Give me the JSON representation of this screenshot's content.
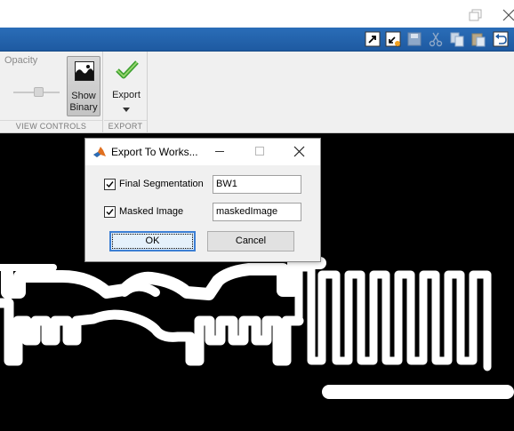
{
  "window": {
    "restore_icon": "restore-icon",
    "close_icon": "close-icon"
  },
  "quick_access": {
    "icons": [
      "undock-icon",
      "dock-icon",
      "save-icon",
      "cut-icon",
      "copy-icon",
      "paste-icon",
      "undo-icon"
    ]
  },
  "toolstrip": {
    "view_controls": {
      "opacity_label": "Opacity",
      "opacity_value": 0.55,
      "show_binary_line1": "Show",
      "show_binary_line2": "Binary",
      "section_label": "VIEW CONTROLS"
    },
    "export": {
      "export_label": "Export",
      "section_label": "EXPORT"
    }
  },
  "dialog": {
    "title": "Export To Works...",
    "rows": [
      {
        "checked": true,
        "label": "Final Segmentation",
        "value": "BW1"
      },
      {
        "checked": true,
        "label": "Masked Image",
        "value": "maskedImage"
      }
    ],
    "ok_label": "OK",
    "cancel_label": "Cancel"
  },
  "colors": {
    "tabstrip": "#1e5aa1",
    "canvas_background": "#000000",
    "foreground": "#ffffff",
    "focus": "#3c7fd4"
  }
}
